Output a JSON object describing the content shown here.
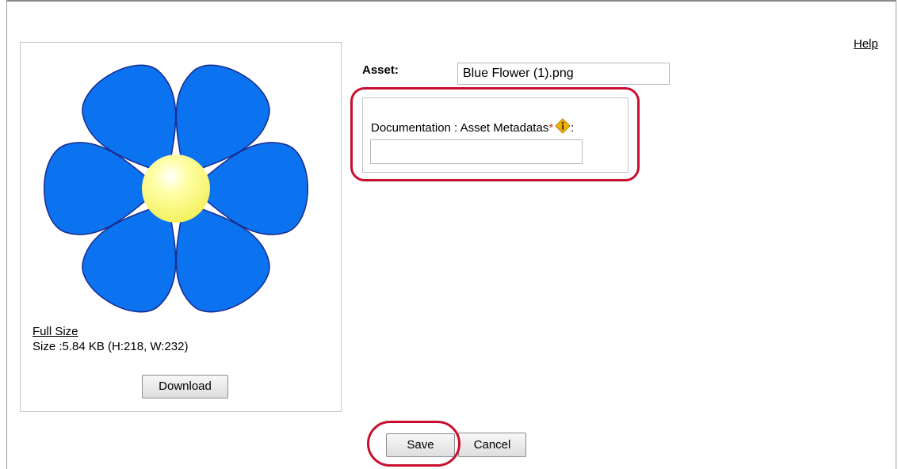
{
  "header": {
    "help_label": "Help"
  },
  "preview": {
    "image_name": "blue-flower-image",
    "full_size_label": "Full Size",
    "size_text": "Size :5.84 KB (H:218, W:232)",
    "download_label": "Download"
  },
  "form": {
    "asset_label": "Asset:",
    "asset_value": "Blue Flower (1).png",
    "metadata_label": "Documentation : Asset Metadatas",
    "required_marker": "*",
    "label_suffix": ":",
    "info_icon": "info-icon",
    "metadata_value": ""
  },
  "actions": {
    "save_label": "Save",
    "cancel_label": "Cancel"
  },
  "colors": {
    "petal_fill": "#0b72f0",
    "petal_stroke": "#1a2a8c",
    "center_fill": "#ffff88",
    "highlight": "#c8102e",
    "required": "#d03030",
    "info_icon": "#f0b400"
  }
}
